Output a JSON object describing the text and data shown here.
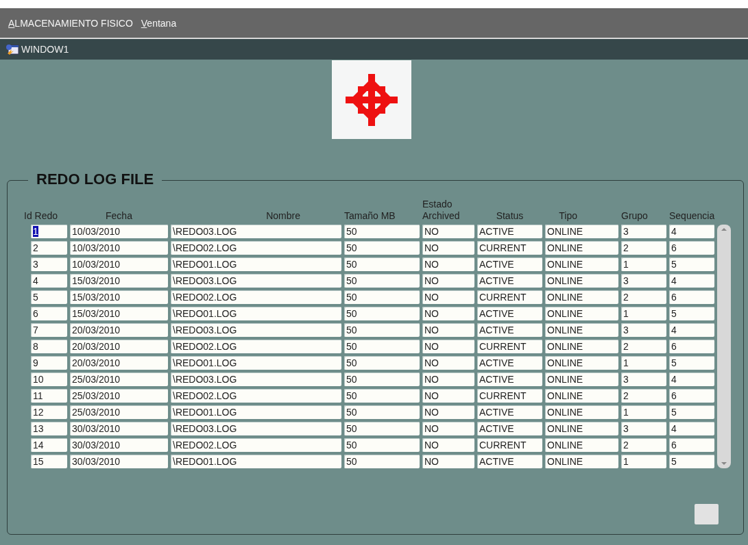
{
  "menu_bar": {
    "items": [
      {
        "label": "ALMACENAMIENTO FISICO"
      },
      {
        "label": "Ventana"
      }
    ]
  },
  "window": {
    "title": "WINDOW1"
  },
  "frame": {
    "title": "REDO LOG FILE"
  },
  "table": {
    "columns": [
      {
        "label": "Id Redo"
      },
      {
        "label": "Fecha"
      },
      {
        "label": "Nombre"
      },
      {
        "label": "Tamaño MB"
      },
      {
        "label": "Estado Archived"
      },
      {
        "label": "Status"
      },
      {
        "label": "Tipo"
      },
      {
        "label": "Grupo"
      },
      {
        "label": "Sequencia"
      }
    ],
    "rows": [
      {
        "selected": true,
        "cells": [
          "1",
          "10/03/2010",
          "\\REDO03.LOG",
          "50",
          "NO",
          "ACTIVE",
          "ONLINE",
          "3",
          "4"
        ]
      },
      {
        "selected": false,
        "cells": [
          "2",
          "10/03/2010",
          "\\REDO02.LOG",
          "50",
          "NO",
          "CURRENT",
          "ONLINE",
          "2",
          "6"
        ]
      },
      {
        "selected": false,
        "cells": [
          "3",
          "10/03/2010",
          "\\REDO01.LOG",
          "50",
          "NO",
          "ACTIVE",
          "ONLINE",
          "1",
          "5"
        ]
      },
      {
        "selected": false,
        "cells": [
          "4",
          "15/03/2010",
          "\\REDO03.LOG",
          "50",
          "NO",
          "ACTIVE",
          "ONLINE",
          "3",
          "4"
        ]
      },
      {
        "selected": false,
        "cells": [
          "5",
          "15/03/2010",
          "\\REDO02.LOG",
          "50",
          "NO",
          "CURRENT",
          "ONLINE",
          "2",
          "6"
        ]
      },
      {
        "selected": false,
        "cells": [
          "6",
          "15/03/2010",
          "\\REDO01.LOG",
          "50",
          "NO",
          "ACTIVE",
          "ONLINE",
          "1",
          "5"
        ]
      },
      {
        "selected": false,
        "cells": [
          "7",
          "20/03/2010",
          "\\REDO03.LOG",
          "50",
          "NO",
          "ACTIVE",
          "ONLINE",
          "3",
          "4"
        ]
      },
      {
        "selected": false,
        "cells": [
          "8",
          "20/03/2010",
          "\\REDO02.LOG",
          "50",
          "NO",
          "CURRENT",
          "ONLINE",
          "2",
          "6"
        ]
      },
      {
        "selected": false,
        "cells": [
          "9",
          "20/03/2010",
          "\\REDO01.LOG",
          "50",
          "NO",
          "ACTIVE",
          "ONLINE",
          "1",
          "5"
        ]
      },
      {
        "selected": false,
        "cells": [
          "10",
          "25/03/2010",
          "\\REDO03.LOG",
          "50",
          "NO",
          "ACTIVE",
          "ONLINE",
          "3",
          "4"
        ]
      },
      {
        "selected": false,
        "cells": [
          "11",
          "25/03/2010",
          "\\REDO02.LOG",
          "50",
          "NO",
          "CURRENT",
          "ONLINE",
          "2",
          "6"
        ]
      },
      {
        "selected": false,
        "cells": [
          "12",
          "25/03/2010",
          "\\REDO01.LOG",
          "50",
          "NO",
          "ACTIVE",
          "ONLINE",
          "1",
          "5"
        ]
      },
      {
        "selected": false,
        "cells": [
          "13",
          "30/03/2010",
          "\\REDO03.LOG",
          "50",
          "NO",
          "ACTIVE",
          "ONLINE",
          "3",
          "4"
        ]
      },
      {
        "selected": false,
        "cells": [
          "14",
          "30/03/2010",
          "\\REDO02.LOG",
          "50",
          "NO",
          "CURRENT",
          "ONLINE",
          "2",
          "6"
        ]
      },
      {
        "selected": false,
        "cells": [
          "15",
          "30/03/2010",
          "\\REDO01.LOG",
          "50",
          "NO",
          "ACTIVE",
          "ONLINE",
          "1",
          "5"
        ]
      }
    ]
  }
}
